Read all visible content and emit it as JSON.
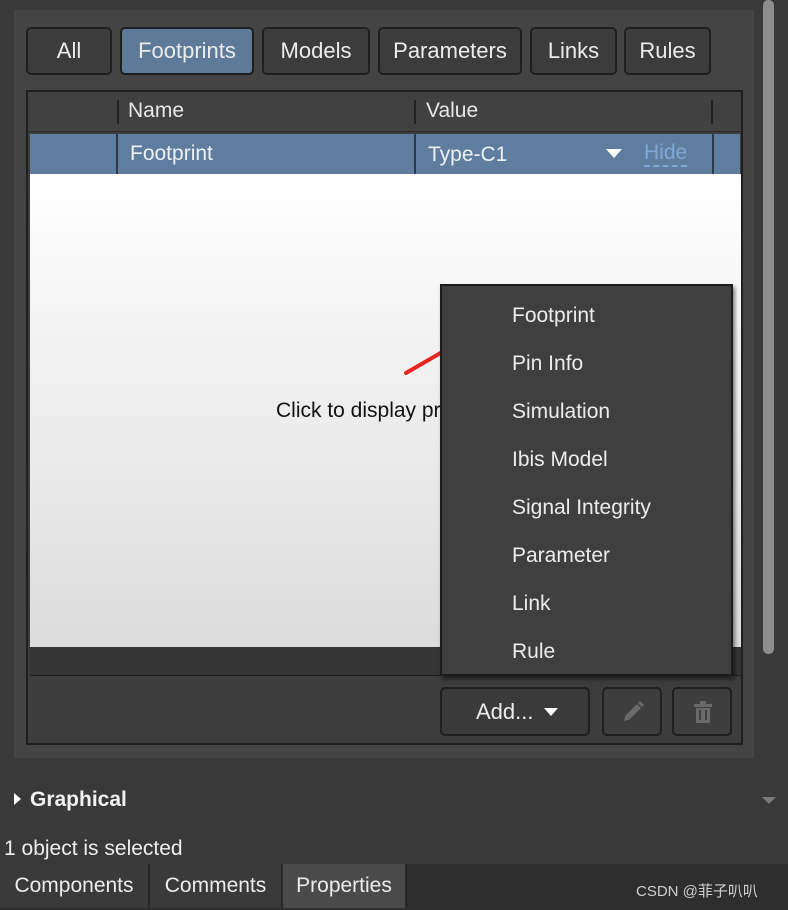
{
  "filter_tabs": [
    "All",
    "Footprints",
    "Models",
    "Parameters",
    "Links",
    "Rules"
  ],
  "active_filter_tab": "Footprints",
  "grid": {
    "headers": {
      "name": "Name",
      "value": "Value"
    },
    "row": {
      "name": "Footprint",
      "value": "Type-C1",
      "hide_link": "Hide"
    }
  },
  "preview": {
    "text": "Click to display preview"
  },
  "add_button": {
    "label": "Add..."
  },
  "add_menu": {
    "items": [
      "Footprint",
      "Pin Info",
      "Simulation",
      "Ibis Model",
      "Signal Integrity",
      "Parameter",
      "Link",
      "Rule"
    ]
  },
  "icons": {
    "edit": "pencil-icon",
    "delete": "trash-icon",
    "annotation": "red-arrow"
  },
  "colors": {
    "active_tab": "#5d7a99",
    "selected_row": "#5f7e9f",
    "hide_link": "#7fa8d6",
    "annotation_arrow": "#e5261f"
  },
  "section": {
    "label": "Graphical"
  },
  "status": {
    "text": "1 object is selected"
  },
  "bottom_tabs": [
    "Components",
    "Comments",
    "Properties"
  ],
  "active_bottom_tab": "Properties",
  "watermark": "CSDN @菲子叭叭"
}
